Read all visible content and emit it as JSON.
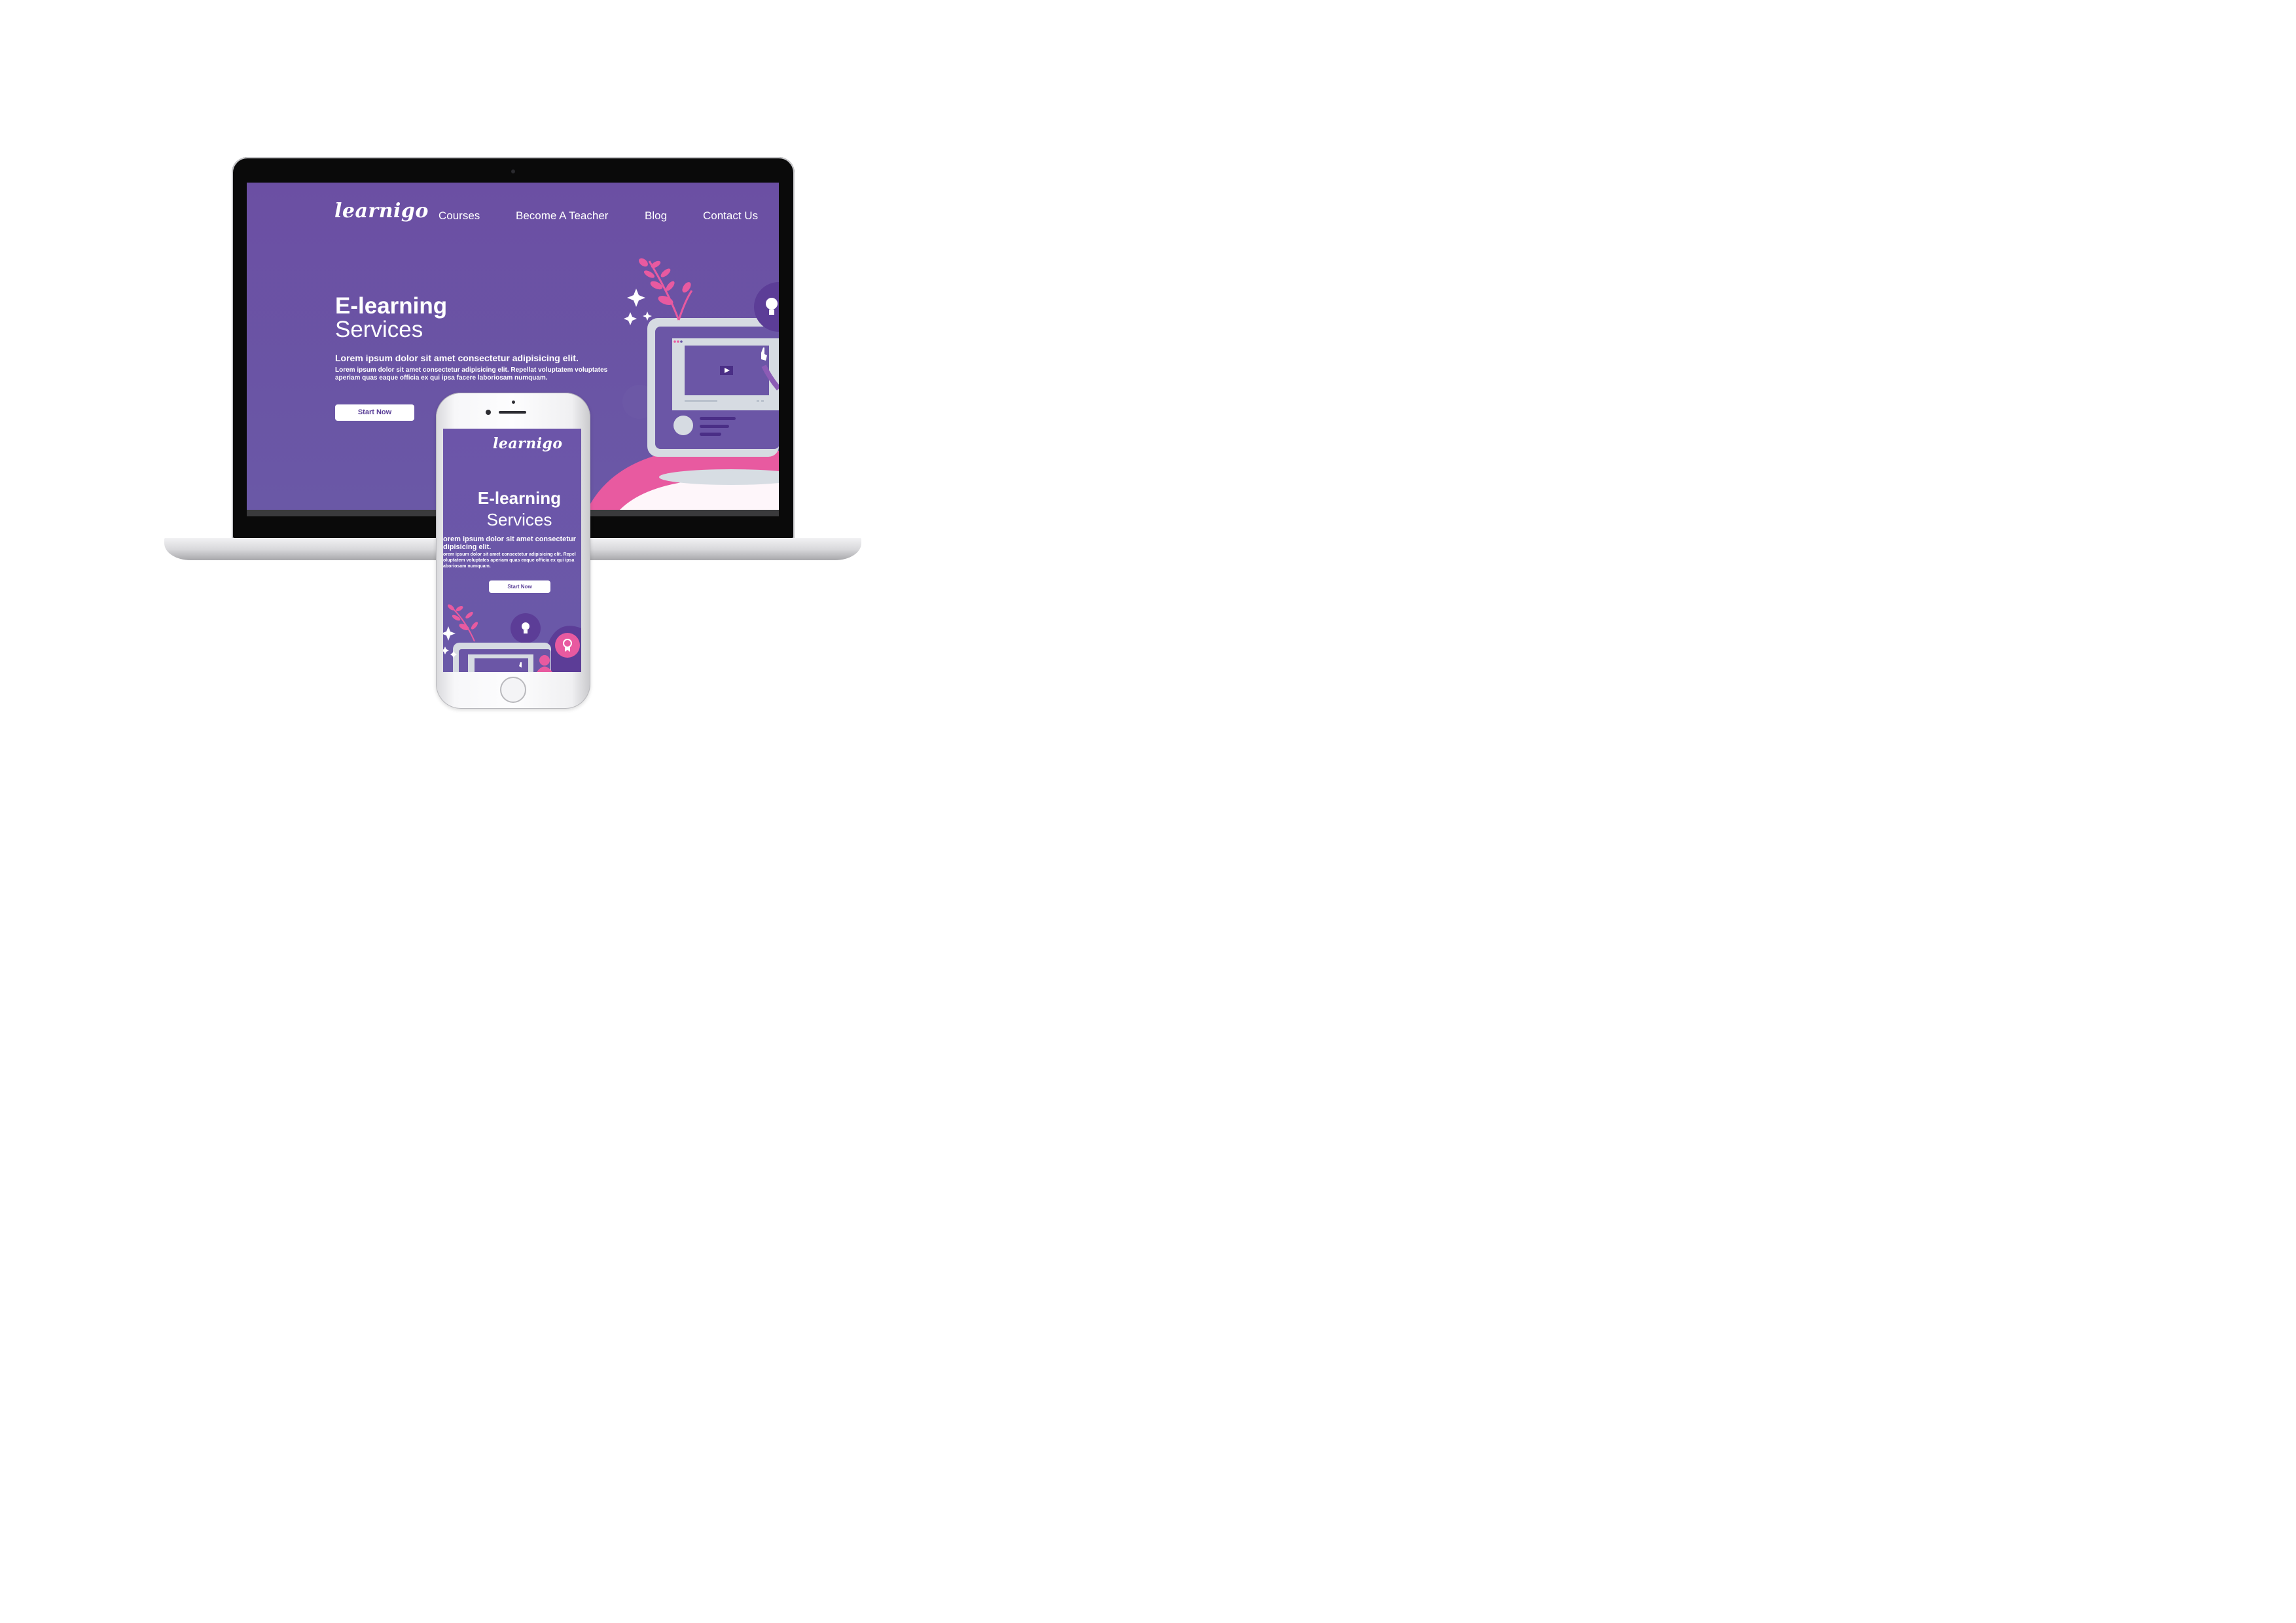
{
  "desktop": {
    "logo": "learnigo",
    "nav": [
      "Courses",
      "Become A Teacher",
      "Blog",
      "Contact Us"
    ],
    "hero": {
      "title_line1": "E-learning",
      "title_line2": "Services",
      "subtitle": "Lorem ipsum dolor sit amet consectetur adipisicing elit.",
      "body_line1": "Lorem ipsum dolor sit amet consectetur adipisicing elit. Repellat voluptatem voluptates",
      "body_line2": "aperiam quas eaque officia ex qui ipsa facere laboriosam numquam.",
      "cta": "Start Now"
    }
  },
  "mobile": {
    "logo": "learnigo",
    "hero": {
      "title_line1": "E-learning",
      "title_line2": "Services",
      "subtitle_line1": "orem ipsum dolor sit amet consectetur",
      "subtitle_line2": "dipisicing elit.",
      "body_line1": "orem ipsum dolor sit amet consectetur adipisicing elit. Repel",
      "body_line2": "oluptatem voluptates aperiam quas eaque officia ex qui ipsa",
      "body_line3": "aboriosam numquam.",
      "cta": "Start Now"
    }
  },
  "colors": {
    "primary_purple": "#6b55a6",
    "accent_pink": "#e8509a",
    "device_white": "#ffffff",
    "panel_grey": "#d6dbe2"
  },
  "icons": [
    "lightbulb-icon",
    "play-icon",
    "sparkle-icon",
    "leaf-icon",
    "award-icon"
  ]
}
